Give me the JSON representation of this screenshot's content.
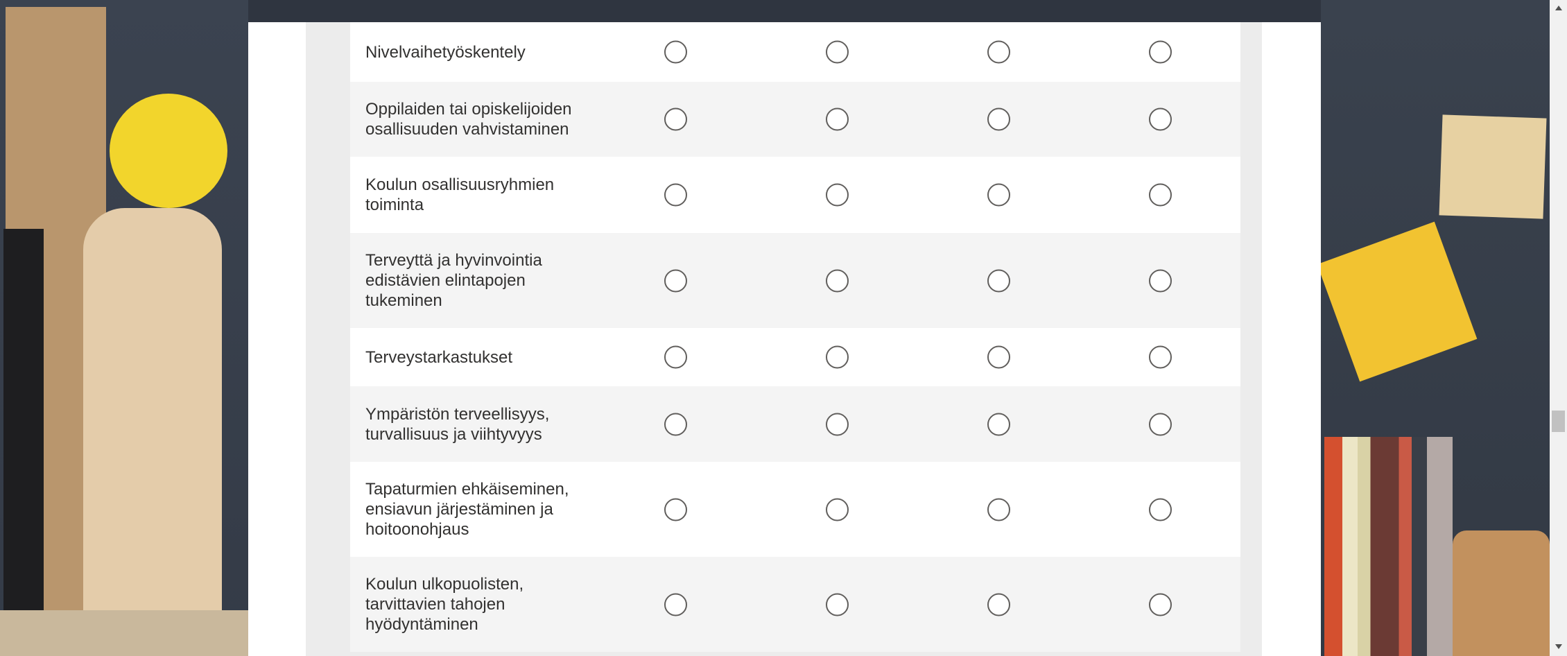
{
  "survey": {
    "rows": [
      {
        "label": "Nivelvaihetyöskentely"
      },
      {
        "label": "Oppilaiden tai opiskelijoiden osallisuuden vahvistaminen"
      },
      {
        "label": "Koulun osallisuusryhmien toiminta"
      },
      {
        "label": "Terveyttä ja hyvinvointia edistävien elintapojen tukeminen"
      },
      {
        "label": "Terveystarkastukset"
      },
      {
        "label": "Ympäristön terveellisyys, turvallisuus ja viihtyvyys"
      },
      {
        "label": "Tapaturmien ehkäiseminen, ensiavun järjestäminen ja hoitoonohjaus"
      },
      {
        "label": "Koulun ulkopuolisten, tarvittavien tahojen hyödyntäminen"
      }
    ]
  },
  "icons": {
    "radio": "radio-button-icon",
    "scroll_up": "arrow-up-icon",
    "scroll_down": "arrow-down-icon"
  },
  "colors": {
    "background_photo": "#343b47",
    "card": "#ffffff",
    "inner_panel": "#ececec",
    "row_alt": "#f4f4f4",
    "text": "#323130",
    "radio_border": "#605e5c"
  }
}
